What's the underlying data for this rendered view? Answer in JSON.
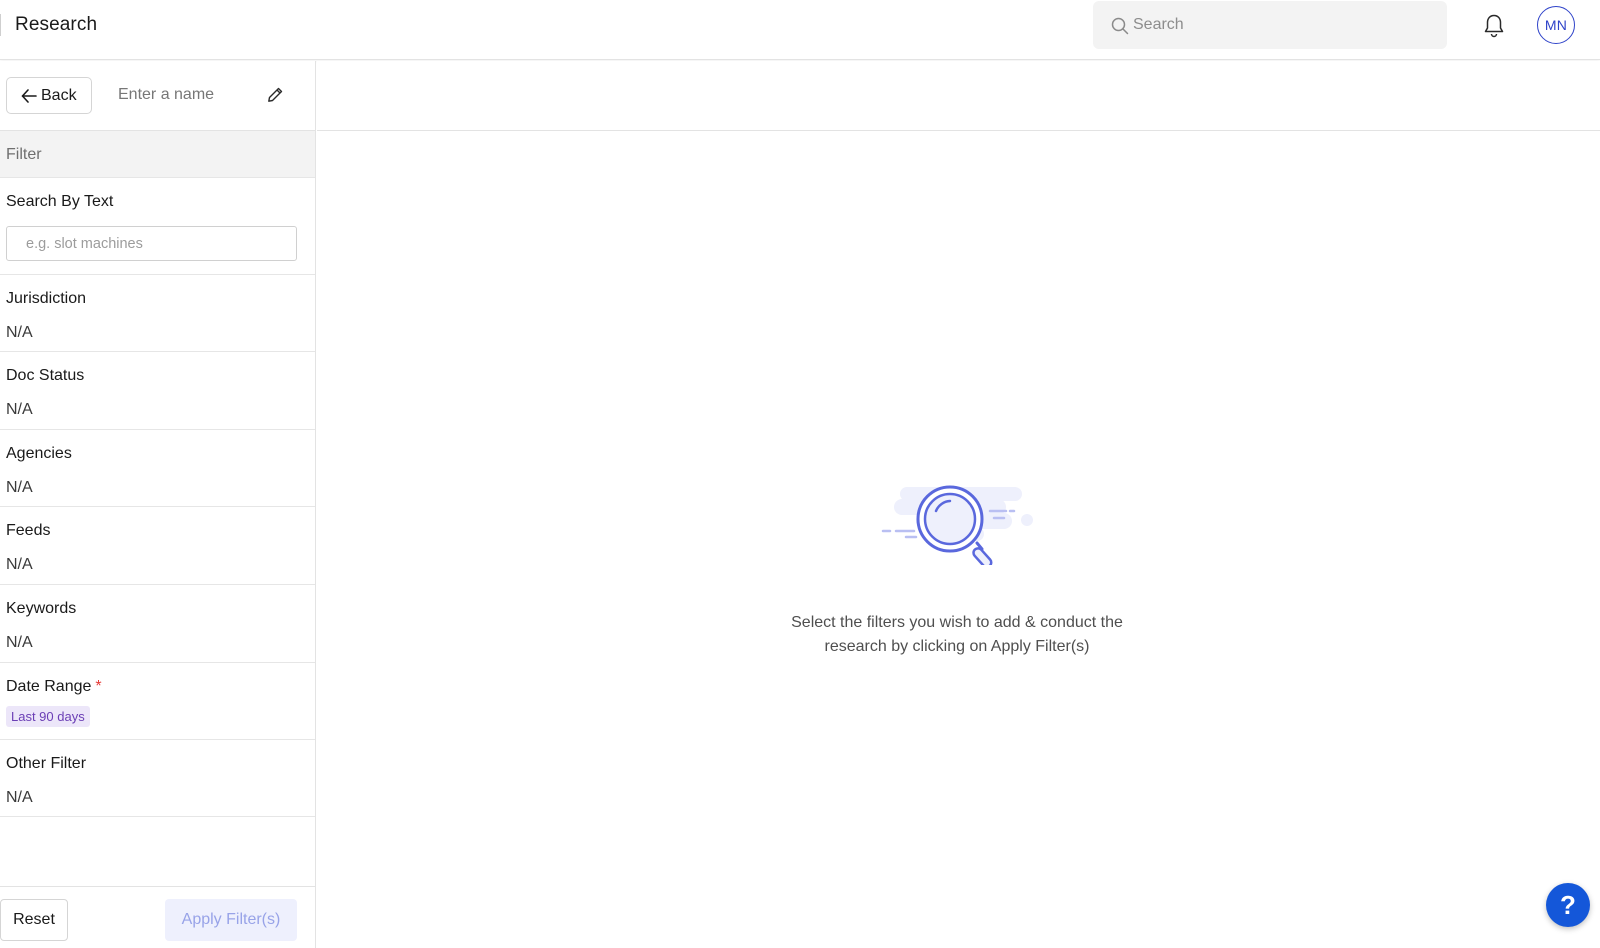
{
  "header": {
    "title": "Research",
    "search_placeholder": "Search",
    "avatar_initials": "MN"
  },
  "sidebar": {
    "back_label": "Back",
    "name_placeholder": "Enter a name",
    "filter_heading": "Filter",
    "search_by_text": {
      "label": "Search By Text",
      "placeholder": "e.g. slot machines"
    },
    "sections": [
      {
        "label": "Jurisdiction",
        "value": "N/A"
      },
      {
        "label": "Doc Status",
        "value": "N/A"
      },
      {
        "label": "Agencies",
        "value": "N/A"
      },
      {
        "label": "Feeds",
        "value": "N/A"
      },
      {
        "label": "Keywords",
        "value": "N/A"
      }
    ],
    "date_range": {
      "label": "Date Range",
      "required_mark": "*",
      "chip": "Last 90 days"
    },
    "other_filter": {
      "label": "Other Filter",
      "value": "N/A"
    },
    "reset_label": "Reset",
    "apply_label": "Apply Filter(s)"
  },
  "main": {
    "empty_line1": "Select the filters you wish to add & conduct the",
    "empty_line2": "research by clicking on Apply Filter(s)"
  },
  "help_label": "?",
  "colors": {
    "accent": "#2f43c9",
    "illustration": "#5a68dd",
    "chip_bg": "#ece6f9",
    "chip_text": "#6b3fb5",
    "help_bg": "#1457d9",
    "required": "#e53935"
  }
}
